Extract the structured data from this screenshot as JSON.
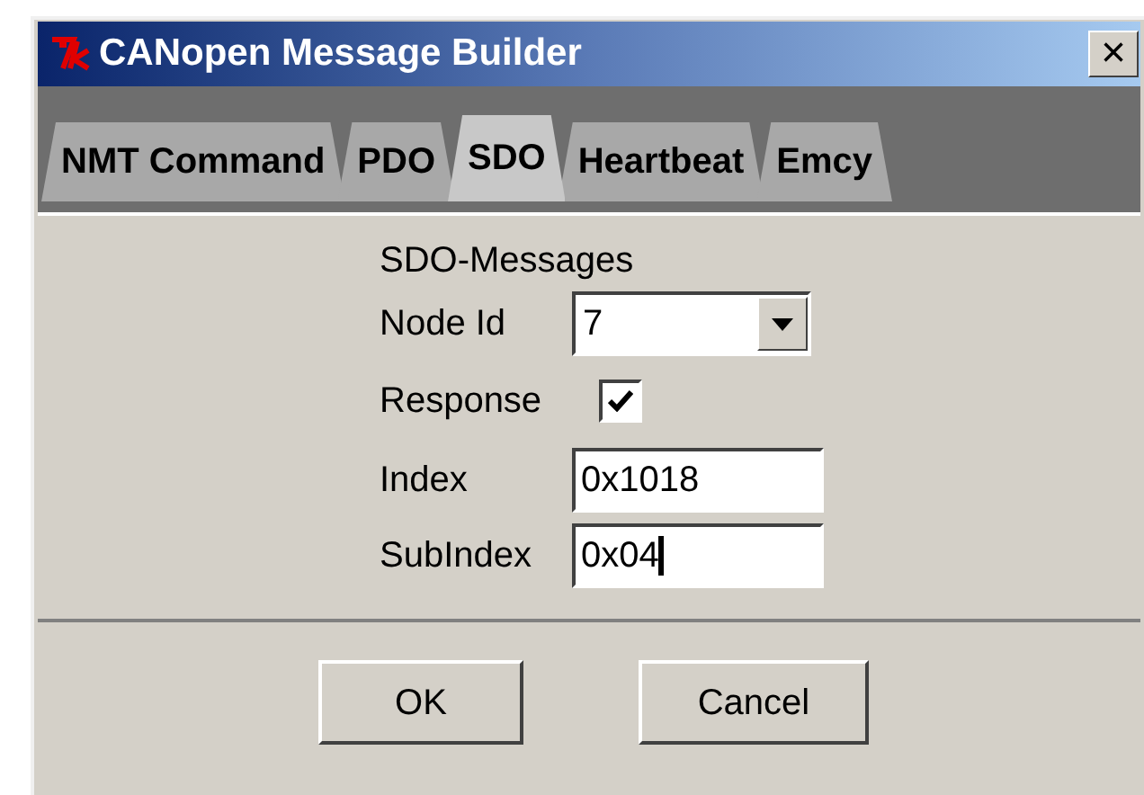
{
  "window": {
    "title": "CANopen Message Builder",
    "close": "×"
  },
  "tabs": [
    {
      "label": "NMT Command",
      "selected": false
    },
    {
      "label": "PDO",
      "selected": false
    },
    {
      "label": "SDO",
      "selected": true
    },
    {
      "label": "Heartbeat",
      "selected": false
    },
    {
      "label": "Emcy",
      "selected": false
    }
  ],
  "form": {
    "heading": "SDO-Messages",
    "node_id": {
      "label": "Node Id",
      "value": "7"
    },
    "response": {
      "label": "Response",
      "checked": true
    },
    "index": {
      "label": "Index",
      "value": "0x1018"
    },
    "subindex": {
      "label": "SubIndex",
      "value": "0x04",
      "focused": true
    }
  },
  "buttons": [
    "OK",
    "Cancel"
  ]
}
